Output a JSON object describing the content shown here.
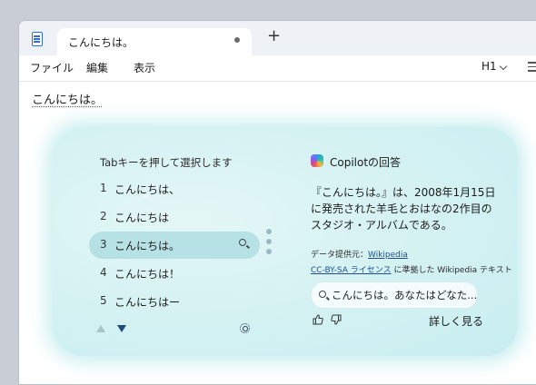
{
  "tab": {
    "title": "こんにちは。"
  },
  "menu": {
    "items": [
      "ファイル",
      "編集",
      "表示"
    ],
    "heading": "H1"
  },
  "document": {
    "text": "こんにちは。"
  },
  "suggestions": {
    "hint": "Tabキーを押して選択します",
    "items": [
      {
        "num": "1",
        "text": "こんにちは、"
      },
      {
        "num": "2",
        "text": "こんにちは"
      },
      {
        "num": "3",
        "text": "こんにちは。"
      },
      {
        "num": "4",
        "text": "こんにちは！"
      },
      {
        "num": "5",
        "text": "こんにちはー"
      }
    ],
    "selected_index": 2
  },
  "copilot": {
    "title": "Copilotの回答",
    "answer": "『こんにちは。』は、2008年1月15日に発売された羊毛とおはなの2作目のスタジオ・アルバムである。",
    "source_label": "データ提供元：",
    "source_link": "Wikipedia",
    "license_link": "CC-BY-SA ライセンス",
    "license_suffix": " に準拠した Wikipedia テキスト",
    "followup": "こんにちは。あなたはどなた...",
    "more": "詳しく見る"
  },
  "icons": [
    "notepad-icon",
    "new-tab-icon",
    "chevron-down-icon",
    "list-icon",
    "search-icon",
    "arrow-up-icon",
    "arrow-down-icon",
    "settings-gear-icon",
    "copilot-icon",
    "thumbs-up-icon",
    "thumbs-down-icon"
  ]
}
